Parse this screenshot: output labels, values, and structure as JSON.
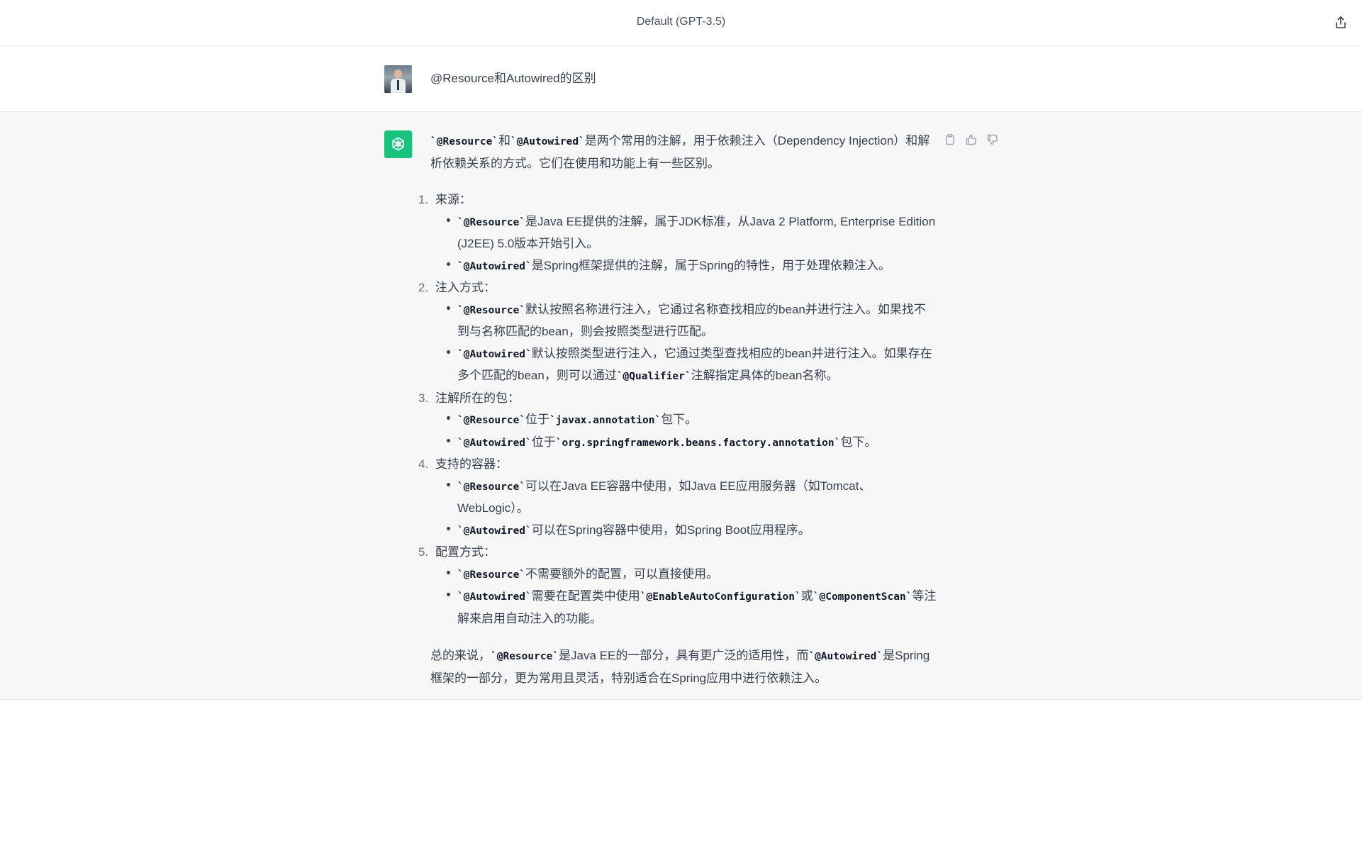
{
  "header": {
    "title": "Default (GPT-3.5)",
    "share_icon": "share-icon"
  },
  "user_message": {
    "text": "@Resource和Autowired的区别"
  },
  "assistant": {
    "action_icons": [
      "copy-icon",
      "thumbs-up-icon",
      "thumbs-down-icon"
    ],
    "intro": {
      "c1": "`@Resource`",
      "t1": "和",
      "c2": "`@Autowired`",
      "t2": "是两个常用的注解，用于依赖注入（Dependency Injection）和解析依赖关系的方式。它们在使用和功能上有一些区别。"
    },
    "sections": [
      {
        "num": "1.",
        "title": "来源：",
        "items": [
          {
            "c1": "`@Resource`",
            "t1": "是Java EE提供的注解，属于JDK标准，从Java 2 Platform, Enterprise Edition (J2EE) 5.0版本开始引入。"
          },
          {
            "c1": "`@Autowired`",
            "t1": "是Spring框架提供的注解，属于Spring的特性，用于处理依赖注入。"
          }
        ]
      },
      {
        "num": "2.",
        "title": "注入方式：",
        "items": [
          {
            "c1": "`@Resource`",
            "t1": "默认按照名称进行注入，它通过名称查找相应的bean并进行注入。如果找不到与名称匹配的bean，则会按照类型进行匹配。"
          },
          {
            "c1": "`@Autowired`",
            "t1": "默认按照类型进行注入，它通过类型查找相应的bean并进行注入。如果存在多个匹配的bean，则可以通过",
            "c2": "`@Qualifier`",
            "t2": "注解指定具体的bean名称。"
          }
        ]
      },
      {
        "num": "3.",
        "title": "注解所在的包：",
        "items": [
          {
            "c1": "`@Resource`",
            "t1": "位于",
            "c2": "`javax.annotation`",
            "t2": "包下。"
          },
          {
            "c1": "`@Autowired`",
            "t1": "位于",
            "c2": "`org.springframework.beans.factory.annotation`",
            "t2": "包下。"
          }
        ]
      },
      {
        "num": "4.",
        "title": "支持的容器：",
        "items": [
          {
            "c1": "`@Resource`",
            "t1": "可以在Java EE容器中使用，如Java EE应用服务器（如Tomcat、WebLogic）。"
          },
          {
            "c1": "`@Autowired`",
            "t1": "可以在Spring容器中使用，如Spring Boot应用程序。"
          }
        ]
      },
      {
        "num": "5.",
        "title": "配置方式：",
        "items": [
          {
            "c1": "`@Resource`",
            "t1": "不需要额外的配置，可以直接使用。"
          },
          {
            "c1": "`@Autowired`",
            "t1": "需要在配置类中使用",
            "c2": "`@EnableAutoConfiguration`",
            "t2": "或",
            "c3": "`@ComponentScan`",
            "t3": "等注解来启用自动注入的功能。"
          }
        ]
      }
    ],
    "outro": {
      "t1": "总的来说，",
      "c1": "`@Resource`",
      "t2": "是Java EE的一部分，具有更广泛的适用性，而",
      "c2": "`@Autowired`",
      "t3": "是Spring框架的一部分，更为常用且灵活，特别适合在Spring应用中进行依赖注入。"
    }
  }
}
